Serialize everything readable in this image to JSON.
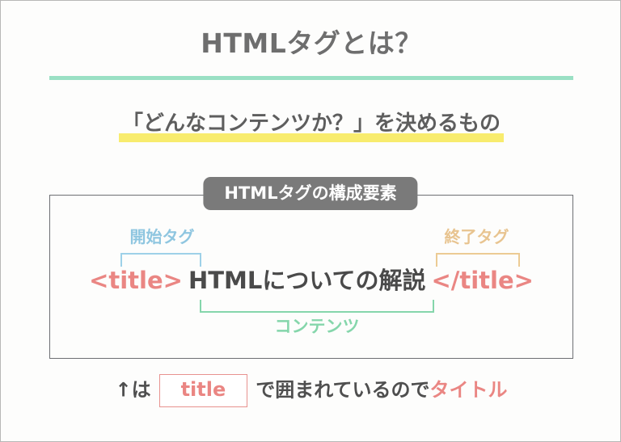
{
  "slide": {
    "title": "HTMLタグとは？",
    "subtitle": "「どんなコンテンツか？」を決めるもの",
    "section_badge": "HTMLタグの構成要素",
    "diagram": {
      "start_tag_label": "開始タグ",
      "end_tag_label": "終了タグ",
      "content_label": "コンテンツ",
      "open_tag": "<title>",
      "content_text": "HTMLについての解説",
      "close_tag": "</title>"
    },
    "caption": {
      "arrow": "↑は",
      "chip": "title",
      "middle": "で囲まれているので",
      "accent": "タイトル"
    }
  },
  "colors": {
    "background": "#fdfdfc",
    "page_border": "#b7b7b7",
    "title_text": "#6e6e6e",
    "title_rule": "#9ae0c4",
    "marker_yellow": "#f8ec6e",
    "badge_bg": "#7a7a7a",
    "badge_text": "#ffffff",
    "box_border": "#6d6f73",
    "start_tag_blue": "#8fc6e0",
    "start_bracket_blue": "#9ed1e8",
    "end_tag_orange": "#e8c490",
    "end_bracket_orange": "#eccb94",
    "content_green": "#85d6ab",
    "tag_salmon": "#ea8683",
    "content_text": "#4a4a4a"
  }
}
